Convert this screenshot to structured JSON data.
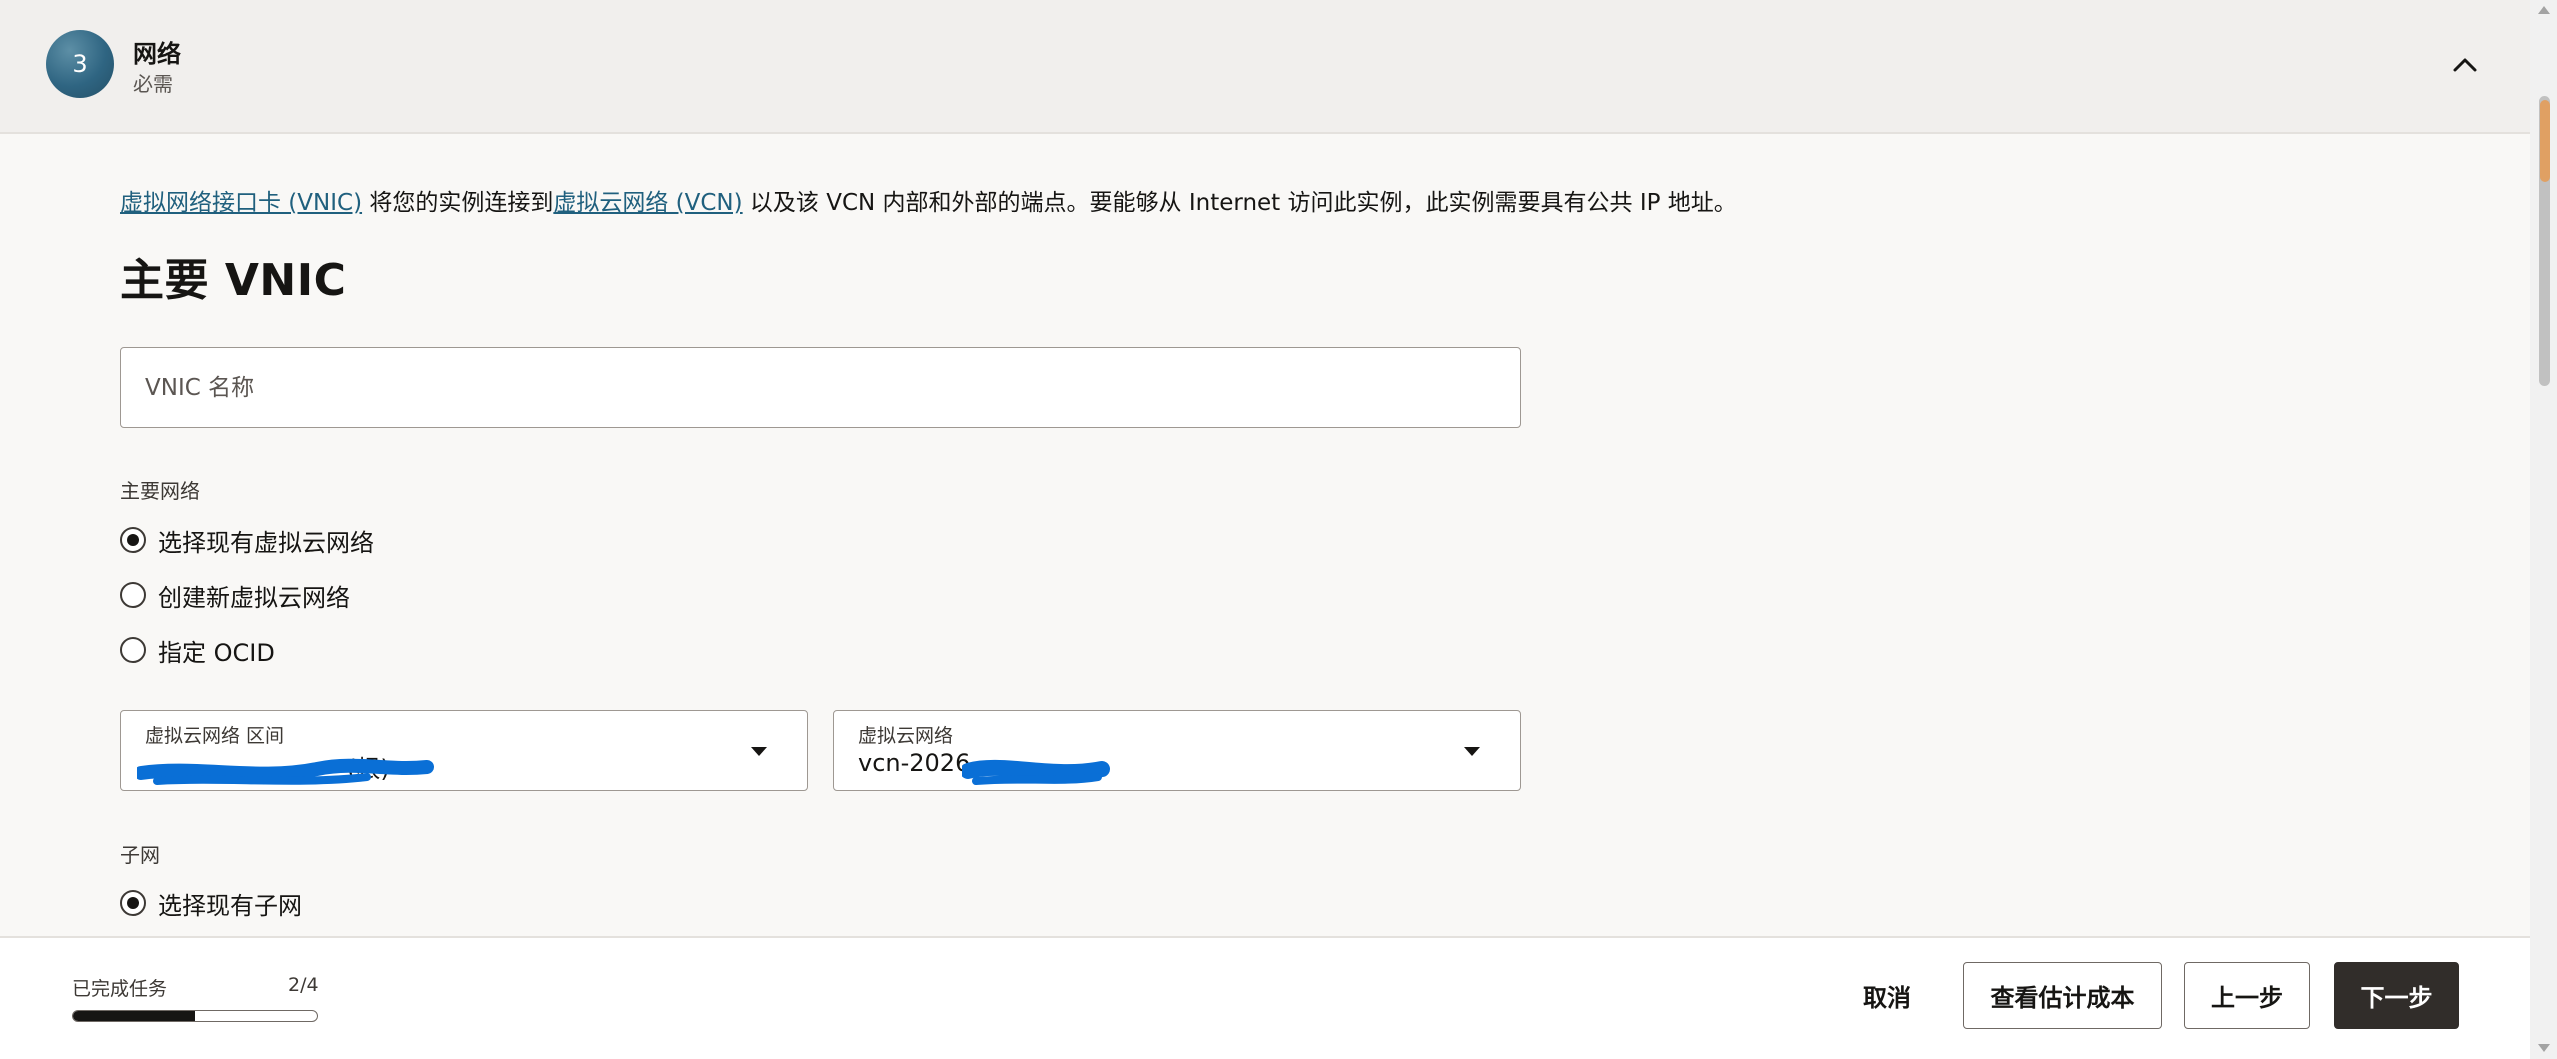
{
  "section": {
    "step_number": "3",
    "title": "网络",
    "subtitle": "必需"
  },
  "intro": {
    "link_vnic": "虚拟网络接口卡 (VNIC)",
    "text_1": " 将您的实例连接到",
    "link_vcn": "虚拟云网络 (VCN)",
    "text_2": " 以及该 VCN 内部和外部的端点。要能够从 Internet 访问此实例，此实例需要具有公共 IP 地址。"
  },
  "primary_vnic": {
    "heading": "主要 VNIC",
    "name_placeholder": "VNIC 名称",
    "name_value": ""
  },
  "primary_network": {
    "label": "主要网络",
    "options": [
      {
        "label": "选择现有虚拟云网络",
        "checked": true
      },
      {
        "label": "创建新虚拟云网络",
        "checked": false
      },
      {
        "label": "指定 OCID",
        "checked": false
      }
    ]
  },
  "selects": {
    "compartment": {
      "label": "虚拟云网络 区间",
      "value": "(根)"
    },
    "vcn": {
      "label": "虚拟云网络",
      "value": "vcn-2026"
    }
  },
  "subnet": {
    "label": "子网",
    "options": [
      {
        "label": "选择现有子网",
        "checked": true
      }
    ]
  },
  "footer": {
    "progress_label": "已完成任务",
    "progress_count": "2/4",
    "progress_fraction": 0.5,
    "cancel": "取消",
    "estimate": "查看估计成本",
    "previous": "上一步",
    "next": "下一步"
  },
  "colors": {
    "link": "#20607e",
    "primary_button": "#312d2a",
    "redaction": "#0a6fd6",
    "step_badge": "#2f6582"
  },
  "icons": {
    "collapse": "chevron-up-icon",
    "dropdown": "caret-down-icon"
  }
}
